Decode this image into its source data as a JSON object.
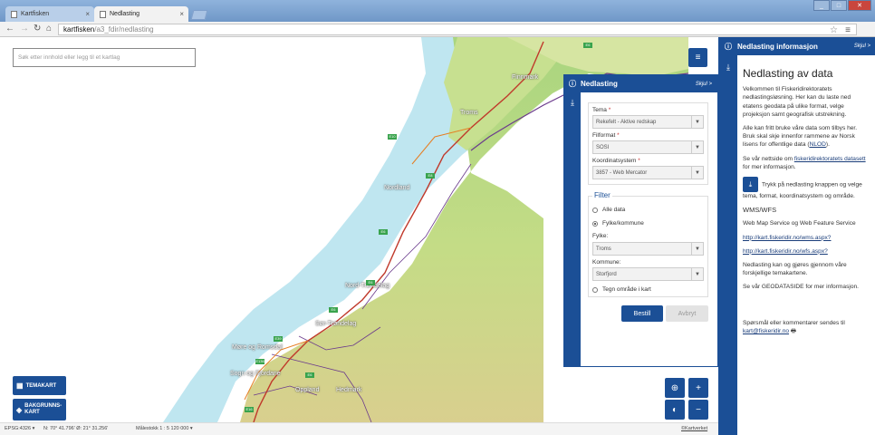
{
  "browser": {
    "tabs": [
      {
        "label": "Kartfisken"
      },
      {
        "label": "Nedlasting"
      }
    ],
    "url_host": "kartfisken",
    "url_path": "/a3_fdir/nedlasting",
    "window_buttons": [
      "_",
      "□",
      "✕"
    ]
  },
  "map": {
    "search_placeholder": "Søk etter innhold eller legg til et kartlag",
    "place_labels": [
      "Finnmark",
      "Troms",
      "Nordland",
      "Nord-Trøndelag",
      "Sør-Trøndelag",
      "Møre og Romsdal",
      "Sogn og Fjordane",
      "Oppland",
      "Hedmark"
    ],
    "road_labels": [
      "E6",
      "E10",
      "E8",
      "E6",
      "E6",
      "E6",
      "E39",
      "E136",
      "E6",
      "E16"
    ],
    "buttons": {
      "temakart": "TEMAKART",
      "bakgrunnskart": "BAKGRUNNS-KART"
    }
  },
  "statusbar": {
    "projection": "EPSG:4326 ▾",
    "coords": "N: 70° 41.796' Ø: 21° 31.256'",
    "scale": "Målestokk 1 : 5 120 000 ▾",
    "copyright": "©Kartverket"
  },
  "download_panel": {
    "title": "Nedlasting",
    "hide_label": "Skjul >",
    "tema_label": "Tema",
    "tema_value": "Rekefelt - Aktive redskap",
    "filformat_label": "Filformat",
    "filformat_value": "SOSI",
    "koordinatsystem_label": "Koordinatsystem",
    "koordinatsystem_value": "3857 - Web Mercator",
    "filter_title": "Filter",
    "radio_all": "Alle data",
    "radio_fylke": "Fylke/kommune",
    "fylke_label": "Fylke:",
    "fylke_value": "Troms",
    "kommune_label": "Kommune:",
    "kommune_value": "Storfjord",
    "radio_area": "Tegn område i kart",
    "order_button": "Bestill",
    "cancel_button": "Avbryt",
    "required_mark": "*"
  },
  "info_panel": {
    "title": "Nedlasting informasjon",
    "hide_label": "Skjul >",
    "heading": "Nedlasting av data",
    "p1": "Velkommen til Fiskeridirektoratets nedlastingsløsning. Her kan du laste ned etatens geodata på ulike format, velge projeksjon samt geografisk utstrekning.",
    "p2_pre": "Alle kan fritt bruke våre data som tilbys her. Bruk skal skje innenfor rammene av Norsk lisens for offentlige data (",
    "p2_link": "NLOD",
    "p2_post": ").",
    "p3_pre": "Se vår nettside om ",
    "p3_link": "fiskeridirektoratets datasett",
    "p3_post": " for mer informasjon.",
    "p4": "Trykk på nedlasting knappen og velge tema, format, koordinatsystem og område.",
    "wms_heading": "WMS/WFS",
    "p5": "Web Map Service og Web Feature Service",
    "wms_link": "http://kart.fiskeridir.no/wms.aspx?",
    "wfs_link": "http://kart.fiskeridir.no/wfs.aspx?",
    "p6": "Nedlasting kan og gjøres gjennom våre forskjellige temakartene.",
    "p7": "Se vår GEODATASIDE for mer informasjon.",
    "contact_pre": "Spørsmål eller kommentarer sendes til ",
    "contact_link": "kart@fiskeridir.no"
  },
  "colors": {
    "brand_blue": "#1b4f96",
    "sea": "#ffffff",
    "land_green": "#9fd07a"
  }
}
